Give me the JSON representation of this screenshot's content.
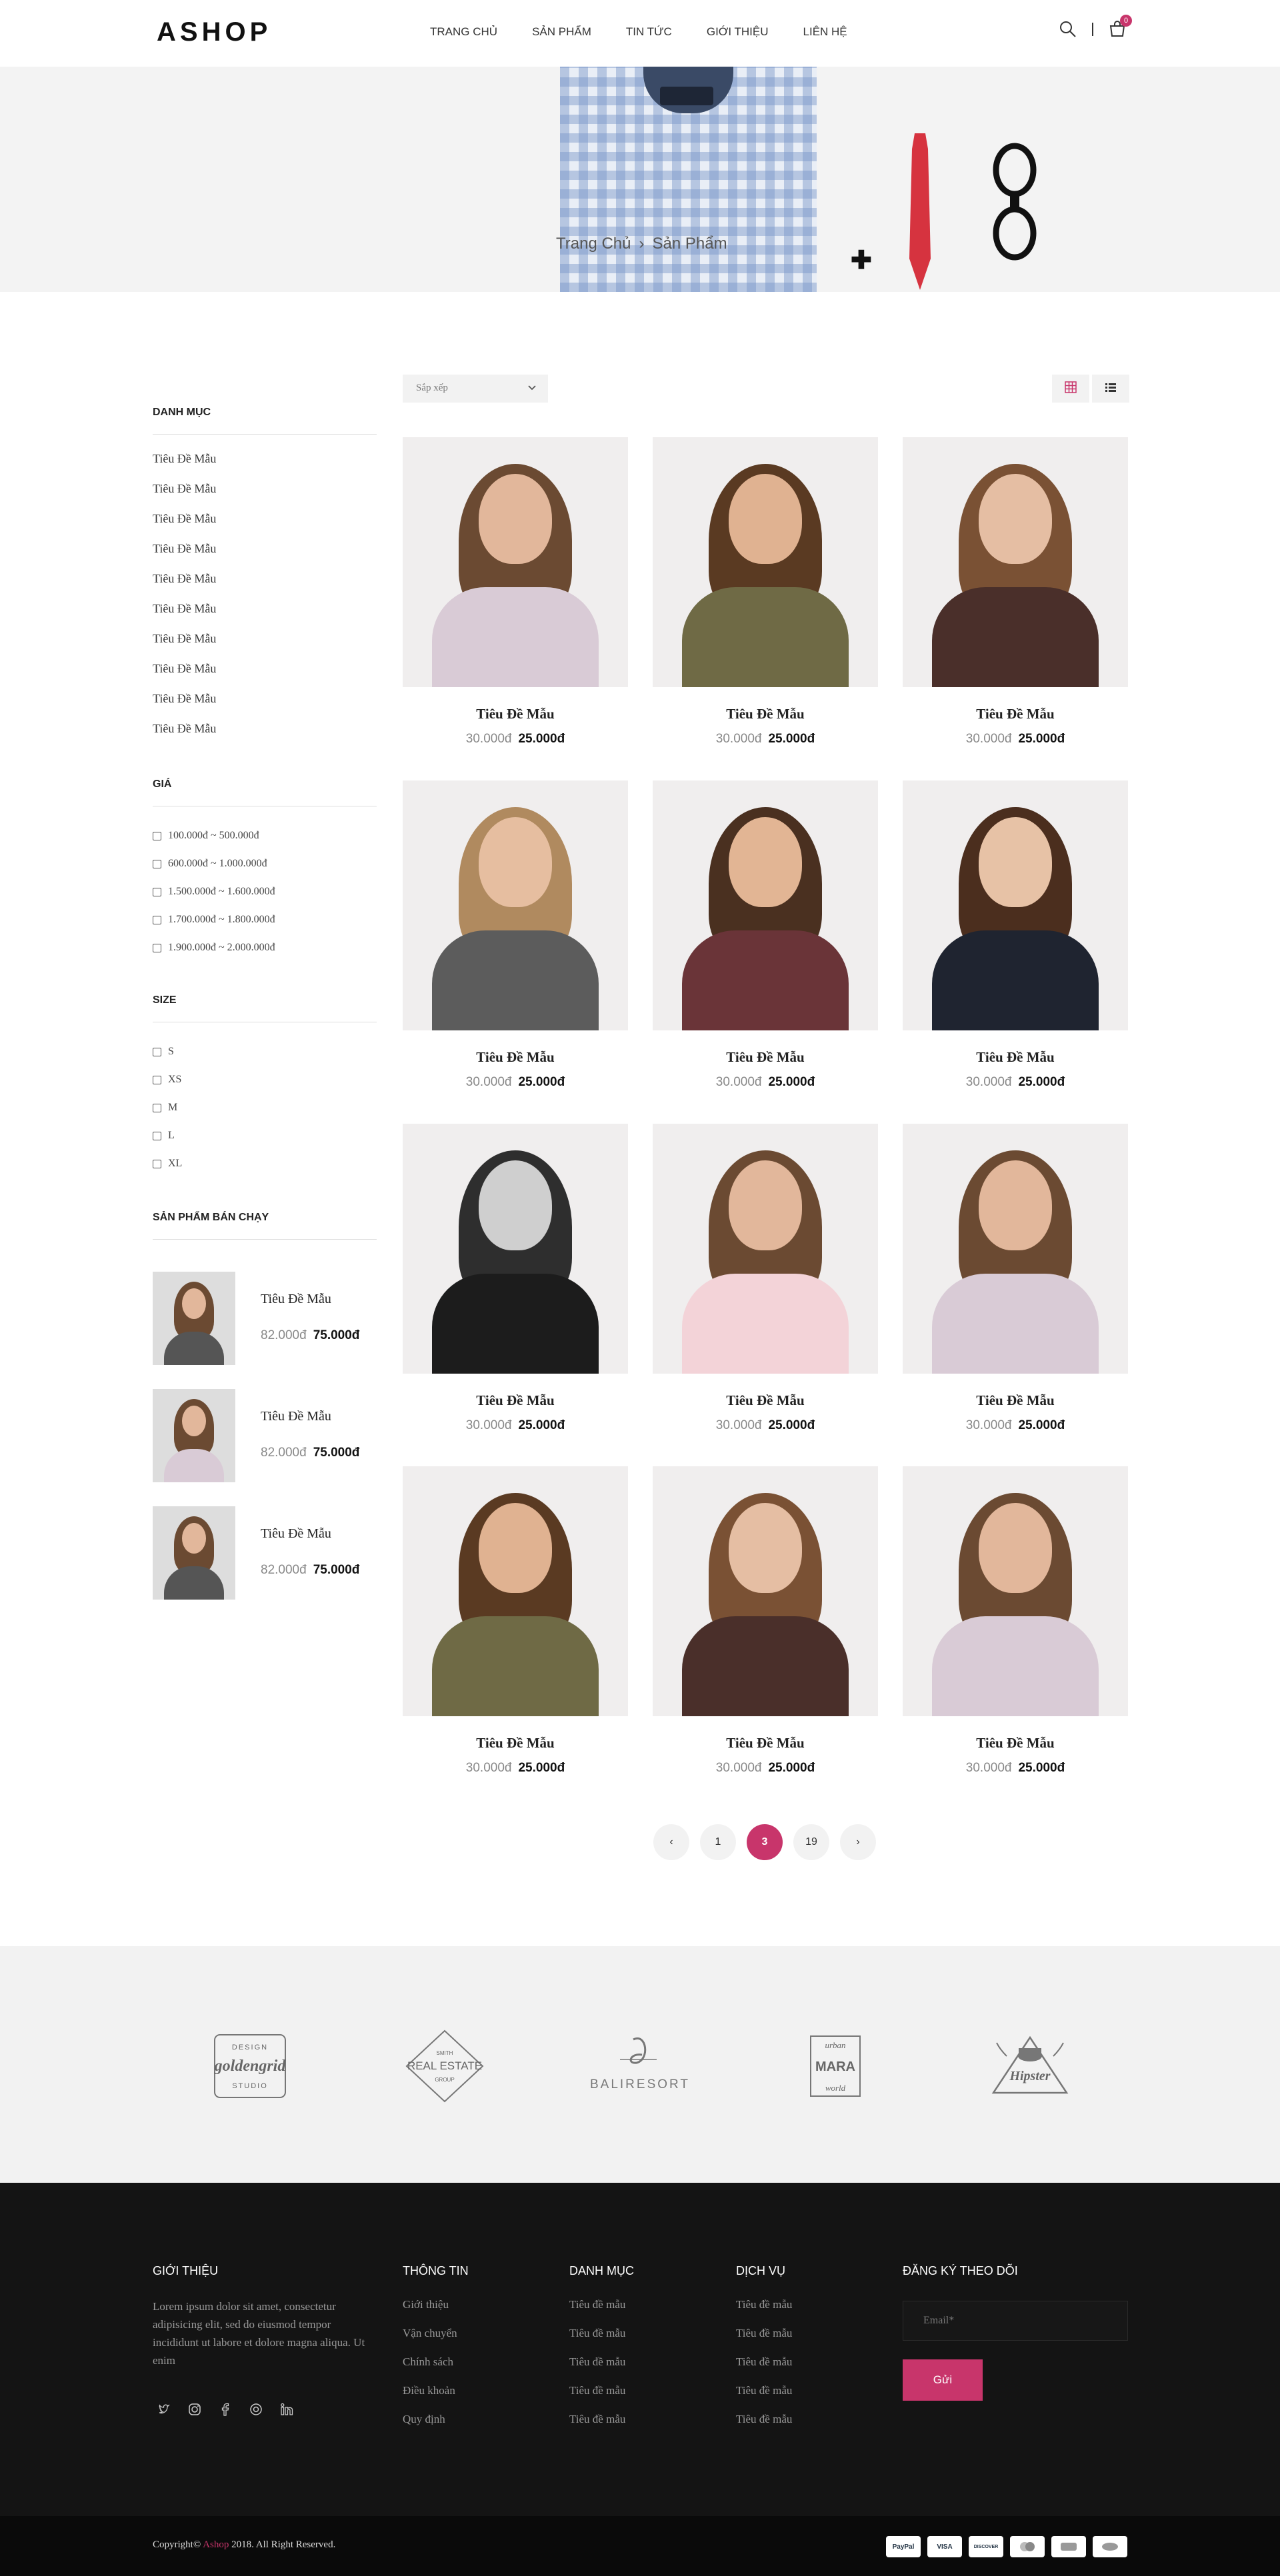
{
  "header": {
    "logo": "ASHOP",
    "nav": [
      "TRANG CHỦ",
      "SẢN PHẨM",
      "TIN TỨC",
      "GIỚI THIỆU",
      "LIÊN HỆ"
    ],
    "cart_count": "0"
  },
  "banner": {
    "crumb_home": "Trang Chủ",
    "crumb_sep": "›",
    "crumb_current": "Sản Phẩm"
  },
  "sidebar": {
    "category_title": "DANH MỤC",
    "categories": [
      "Tiêu Đề Mẫu",
      "Tiêu Đề Mẫu",
      "Tiêu Đề Mẫu",
      "Tiêu Đề Mẫu",
      "Tiêu Đề Mẫu",
      "Tiêu Đề Mẫu",
      "Tiêu Đề Mẫu",
      "Tiêu Đề Mẫu",
      "Tiêu Đề Mẫu",
      "Tiêu Đề Mẫu"
    ],
    "price_title": "GIÁ",
    "prices": [
      "100.000đ ~ 500.000đ",
      "600.000đ ~ 1.000.000đ",
      "1.500.000đ ~ 1.600.000đ",
      "1.700.000đ ~ 1.800.000đ",
      "1.900.000đ ~ 2.000.000đ"
    ],
    "size_title": "SIZE",
    "sizes": [
      "S",
      "XS",
      "M",
      "L",
      "XL"
    ],
    "best_title": "SẢN PHẨM BÁN CHẠY",
    "best": [
      {
        "title": "Tiêu Đề Mẫu",
        "old": "82.000đ",
        "new": "75.000đ"
      },
      {
        "title": "Tiêu Đề Mẫu",
        "old": "82.000đ",
        "new": "75.000đ"
      },
      {
        "title": "Tiêu Đề Mẫu",
        "old": "82.000đ",
        "new": "75.000đ"
      }
    ]
  },
  "toolbar": {
    "sort_placeholder": "Sắp xếp"
  },
  "products": [
    {
      "title": "Tiêu Đề Mẫu",
      "old": "30.000đ",
      "new": "25.000đ"
    },
    {
      "title": "Tiêu Đề Mẫu",
      "old": "30.000đ",
      "new": "25.000đ"
    },
    {
      "title": "Tiêu Đề Mẫu",
      "old": "30.000đ",
      "new": "25.000đ"
    },
    {
      "title": "Tiêu Đề Mẫu",
      "old": "30.000đ",
      "new": "25.000đ"
    },
    {
      "title": "Tiêu Đề Mẫu",
      "old": "30.000đ",
      "new": "25.000đ"
    },
    {
      "title": "Tiêu Đề Mẫu",
      "old": "30.000đ",
      "new": "25.000đ"
    },
    {
      "title": "Tiêu Đề Mẫu",
      "old": "30.000đ",
      "new": "25.000đ"
    },
    {
      "title": "Tiêu Đề Mẫu",
      "old": "30.000đ",
      "new": "25.000đ"
    },
    {
      "title": "Tiêu Đề Mẫu",
      "old": "30.000đ",
      "new": "25.000đ"
    },
    {
      "title": "Tiêu Đề Mẫu",
      "old": "30.000đ",
      "new": "25.000đ"
    },
    {
      "title": "Tiêu Đề Mẫu",
      "old": "30.000đ",
      "new": "25.000đ"
    },
    {
      "title": "Tiêu Đề Mẫu",
      "old": "30.000đ",
      "new": "25.000đ"
    }
  ],
  "pagination": {
    "prev": "‹",
    "pages": [
      "1",
      "3",
      "19"
    ],
    "active": "3",
    "next": "›"
  },
  "brands": {
    "goldengrid_top": "DESIGN",
    "goldengrid_name": "goldengrid",
    "goldengrid_bottom": "STUDIO",
    "realestate_top": "SMITH",
    "realestate_name": "REAL ESTATE",
    "realestate_bottom": "GROUP",
    "baliresort_name": "BALIRESORT",
    "mara_top": "urban",
    "mara_name": "MARA",
    "mara_bottom": "world",
    "hipster_name": "Hipster"
  },
  "footer": {
    "about_title": "GIỚI THIỆU",
    "about_text": "Lorem ipsum dolor sit amet, consectetur adipisicing elit, sed do eiusmod tempor incididunt ut labore et dolore magna aliqua. Ut enim",
    "info_title": "THÔNG TIN",
    "info": [
      "Giới thiệu",
      "Vận chuyển",
      "Chính sách",
      "Điều khoản",
      "Quy định"
    ],
    "cat_title": "DANH MỤC",
    "cat": [
      "Tiêu đề mẫu",
      "Tiêu đề mẫu",
      "Tiêu đề mẫu",
      "Tiêu đề mẫu",
      "Tiêu đề mẫu"
    ],
    "service_title": "DỊCH VỤ",
    "service": [
      "Tiêu đề mẫu",
      "Tiêu đề mẫu",
      "Tiêu đề mẫu",
      "Tiêu đề mẫu",
      "Tiêu đề mẫu"
    ],
    "subscribe_title": "ĐĂNG KÝ THEO DÕI",
    "email_placeholder": "Email*",
    "send_label": "Gửi",
    "copyright_pre": "Copyright© ",
    "copyright_brand": "Ashop",
    "copyright_post": " 2018. All Right Reserved.",
    "payments": [
      "PayPal",
      "VISA",
      "DISCOVER",
      "",
      "",
      ""
    ]
  },
  "colors": {
    "accent": "#c8356b",
    "footer_bg": "#141414"
  }
}
